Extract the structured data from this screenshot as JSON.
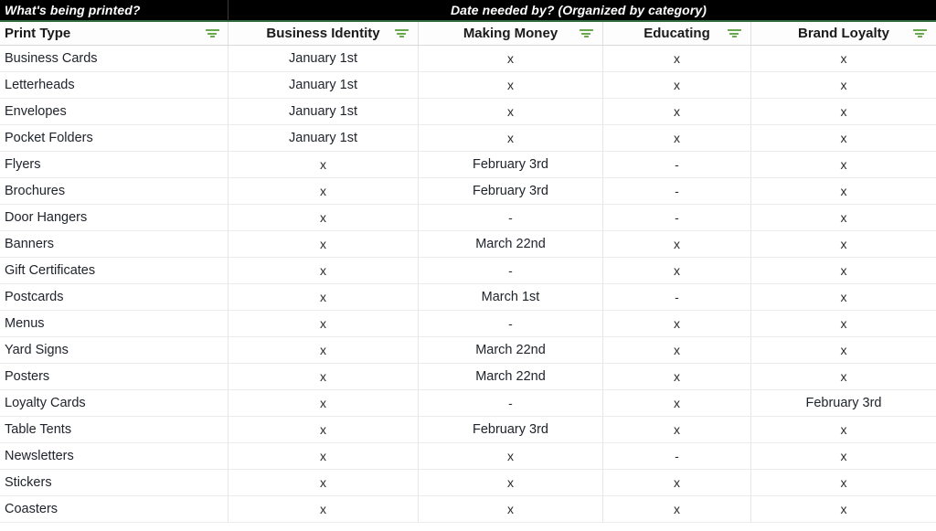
{
  "banner": {
    "left_title": "What's being printed?",
    "right_title": "Date needed by? (Organized by category)",
    "background": "#000000",
    "accent_underline": "#2f6b3c"
  },
  "filter_icon": {
    "name": "filter-icon",
    "color": "#6aa84f"
  },
  "table": {
    "columns": [
      {
        "label": "Print Type",
        "align": "left",
        "filter": true
      },
      {
        "label": "Business Identity",
        "align": "center",
        "filter": true
      },
      {
        "label": "Making Money",
        "align": "center",
        "filter": true
      },
      {
        "label": "Educating",
        "align": "center",
        "filter": true
      },
      {
        "label": "Brand Loyalty",
        "align": "center",
        "filter": true
      }
    ],
    "rows": [
      {
        "print_type": "Business Cards",
        "business_identity": "January 1st",
        "making_money": "x",
        "educating": "x",
        "brand_loyalty": "x"
      },
      {
        "print_type": "Letterheads",
        "business_identity": "January 1st",
        "making_money": "x",
        "educating": "x",
        "brand_loyalty": "x"
      },
      {
        "print_type": "Envelopes",
        "business_identity": "January 1st",
        "making_money": "x",
        "educating": "x",
        "brand_loyalty": "x"
      },
      {
        "print_type": "Pocket Folders",
        "business_identity": "January 1st",
        "making_money": "x",
        "educating": "x",
        "brand_loyalty": "x"
      },
      {
        "print_type": "Flyers",
        "business_identity": "x",
        "making_money": "February 3rd",
        "educating": "-",
        "brand_loyalty": "x"
      },
      {
        "print_type": "Brochures",
        "business_identity": "x",
        "making_money": "February 3rd",
        "educating": "-",
        "brand_loyalty": "x"
      },
      {
        "print_type": "Door Hangers",
        "business_identity": "x",
        "making_money": "-",
        "educating": "-",
        "brand_loyalty": "x"
      },
      {
        "print_type": "Banners",
        "business_identity": "x",
        "making_money": "March 22nd",
        "educating": "x",
        "brand_loyalty": "x"
      },
      {
        "print_type": "Gift Certificates",
        "business_identity": "x",
        "making_money": "-",
        "educating": "x",
        "brand_loyalty": "x"
      },
      {
        "print_type": "Postcards",
        "business_identity": "x",
        "making_money": "March 1st",
        "educating": "-",
        "brand_loyalty": "x"
      },
      {
        "print_type": "Menus",
        "business_identity": "x",
        "making_money": "-",
        "educating": "x",
        "brand_loyalty": "x"
      },
      {
        "print_type": "Yard Signs",
        "business_identity": "x",
        "making_money": "March 22nd",
        "educating": "x",
        "brand_loyalty": "x"
      },
      {
        "print_type": "Posters",
        "business_identity": "x",
        "making_money": "March 22nd",
        "educating": "x",
        "brand_loyalty": "x"
      },
      {
        "print_type": "Loyalty Cards",
        "business_identity": "x",
        "making_money": "-",
        "educating": "x",
        "brand_loyalty": "February 3rd"
      },
      {
        "print_type": "Table Tents",
        "business_identity": "x",
        "making_money": "February 3rd",
        "educating": "x",
        "brand_loyalty": "x"
      },
      {
        "print_type": "Newsletters",
        "business_identity": "x",
        "making_money": "x",
        "educating": "-",
        "brand_loyalty": "x"
      },
      {
        "print_type": "Stickers",
        "business_identity": "x",
        "making_money": "x",
        "educating": "x",
        "brand_loyalty": "x"
      },
      {
        "print_type": "Coasters",
        "business_identity": "x",
        "making_money": "x",
        "educating": "x",
        "brand_loyalty": "x"
      }
    ]
  }
}
